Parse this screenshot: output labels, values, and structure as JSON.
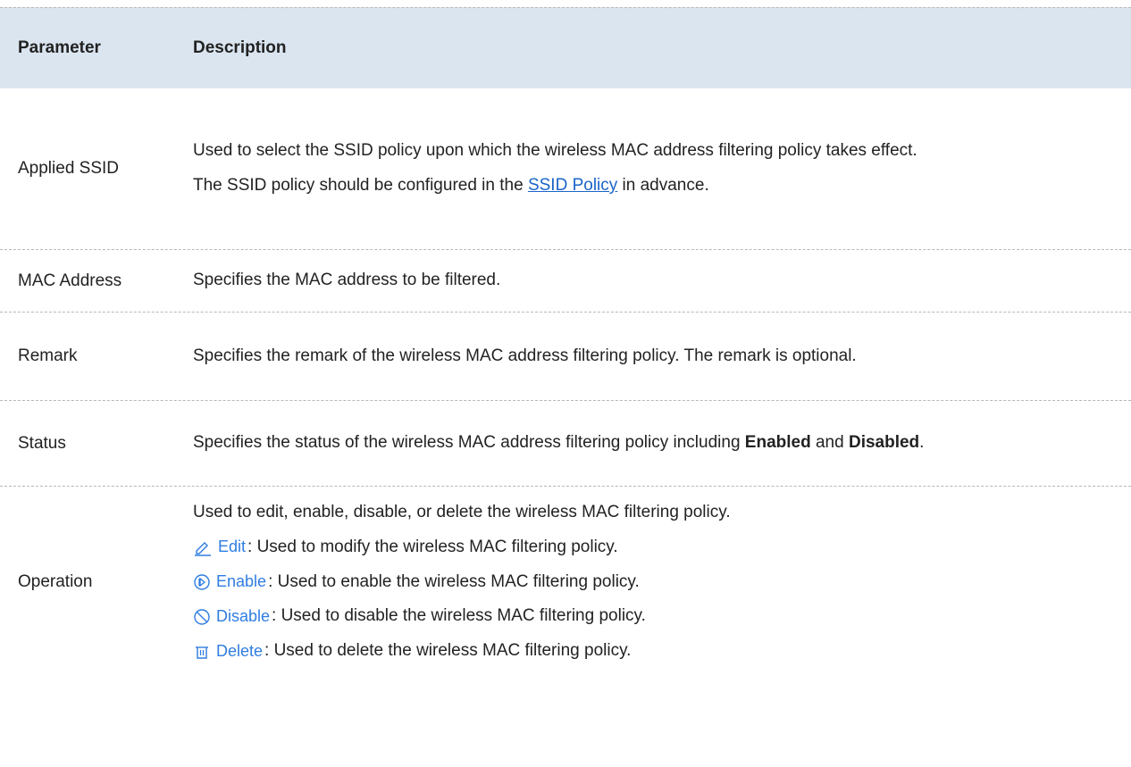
{
  "header": {
    "parameter": "Parameter",
    "description": "Description"
  },
  "rows": {
    "ssid": {
      "param": "Applied SSID",
      "desc1": "Used to select the SSID policy upon which the wireless MAC address filtering policy takes effect.",
      "desc2_before": "The SSID policy should be configured in the ",
      "desc2_link": "SSID Policy",
      "desc2_after": " in advance."
    },
    "mac": {
      "param": "MAC Address",
      "desc": "Specifies the MAC address to be filtered."
    },
    "remark": {
      "param": "Remark",
      "desc": "Specifies the remark of the wireless MAC address filtering policy. The remark is optional."
    },
    "status": {
      "param": "Status",
      "desc_before": "Specifies the status of the wireless MAC address filtering policy including ",
      "enabled": "Enabled",
      "and": " and ",
      "disabled": "Disabled",
      "period": "."
    },
    "operation": {
      "param": "Operation",
      "intro": "Used to edit, enable, disable, or delete the wireless MAC filtering policy.",
      "edit_label": "Edit",
      "edit_desc": ": Used to modify the wireless MAC filtering policy.",
      "enable_label": "Enable",
      "enable_desc": ": Used to enable the wireless MAC filtering policy.",
      "disable_label": "Disable",
      "disable_desc": " : Used to disable the wireless MAC filtering policy.",
      "delete_label": "Delete",
      "delete_desc": " : Used to delete the wireless MAC filtering policy."
    }
  },
  "colors": {
    "header_bg": "#dae5f0",
    "link": "#1a64c8",
    "button_text": "#2f7de1"
  },
  "icons": [
    "edit-icon",
    "enable-icon",
    "disable-icon",
    "delete-icon"
  ]
}
